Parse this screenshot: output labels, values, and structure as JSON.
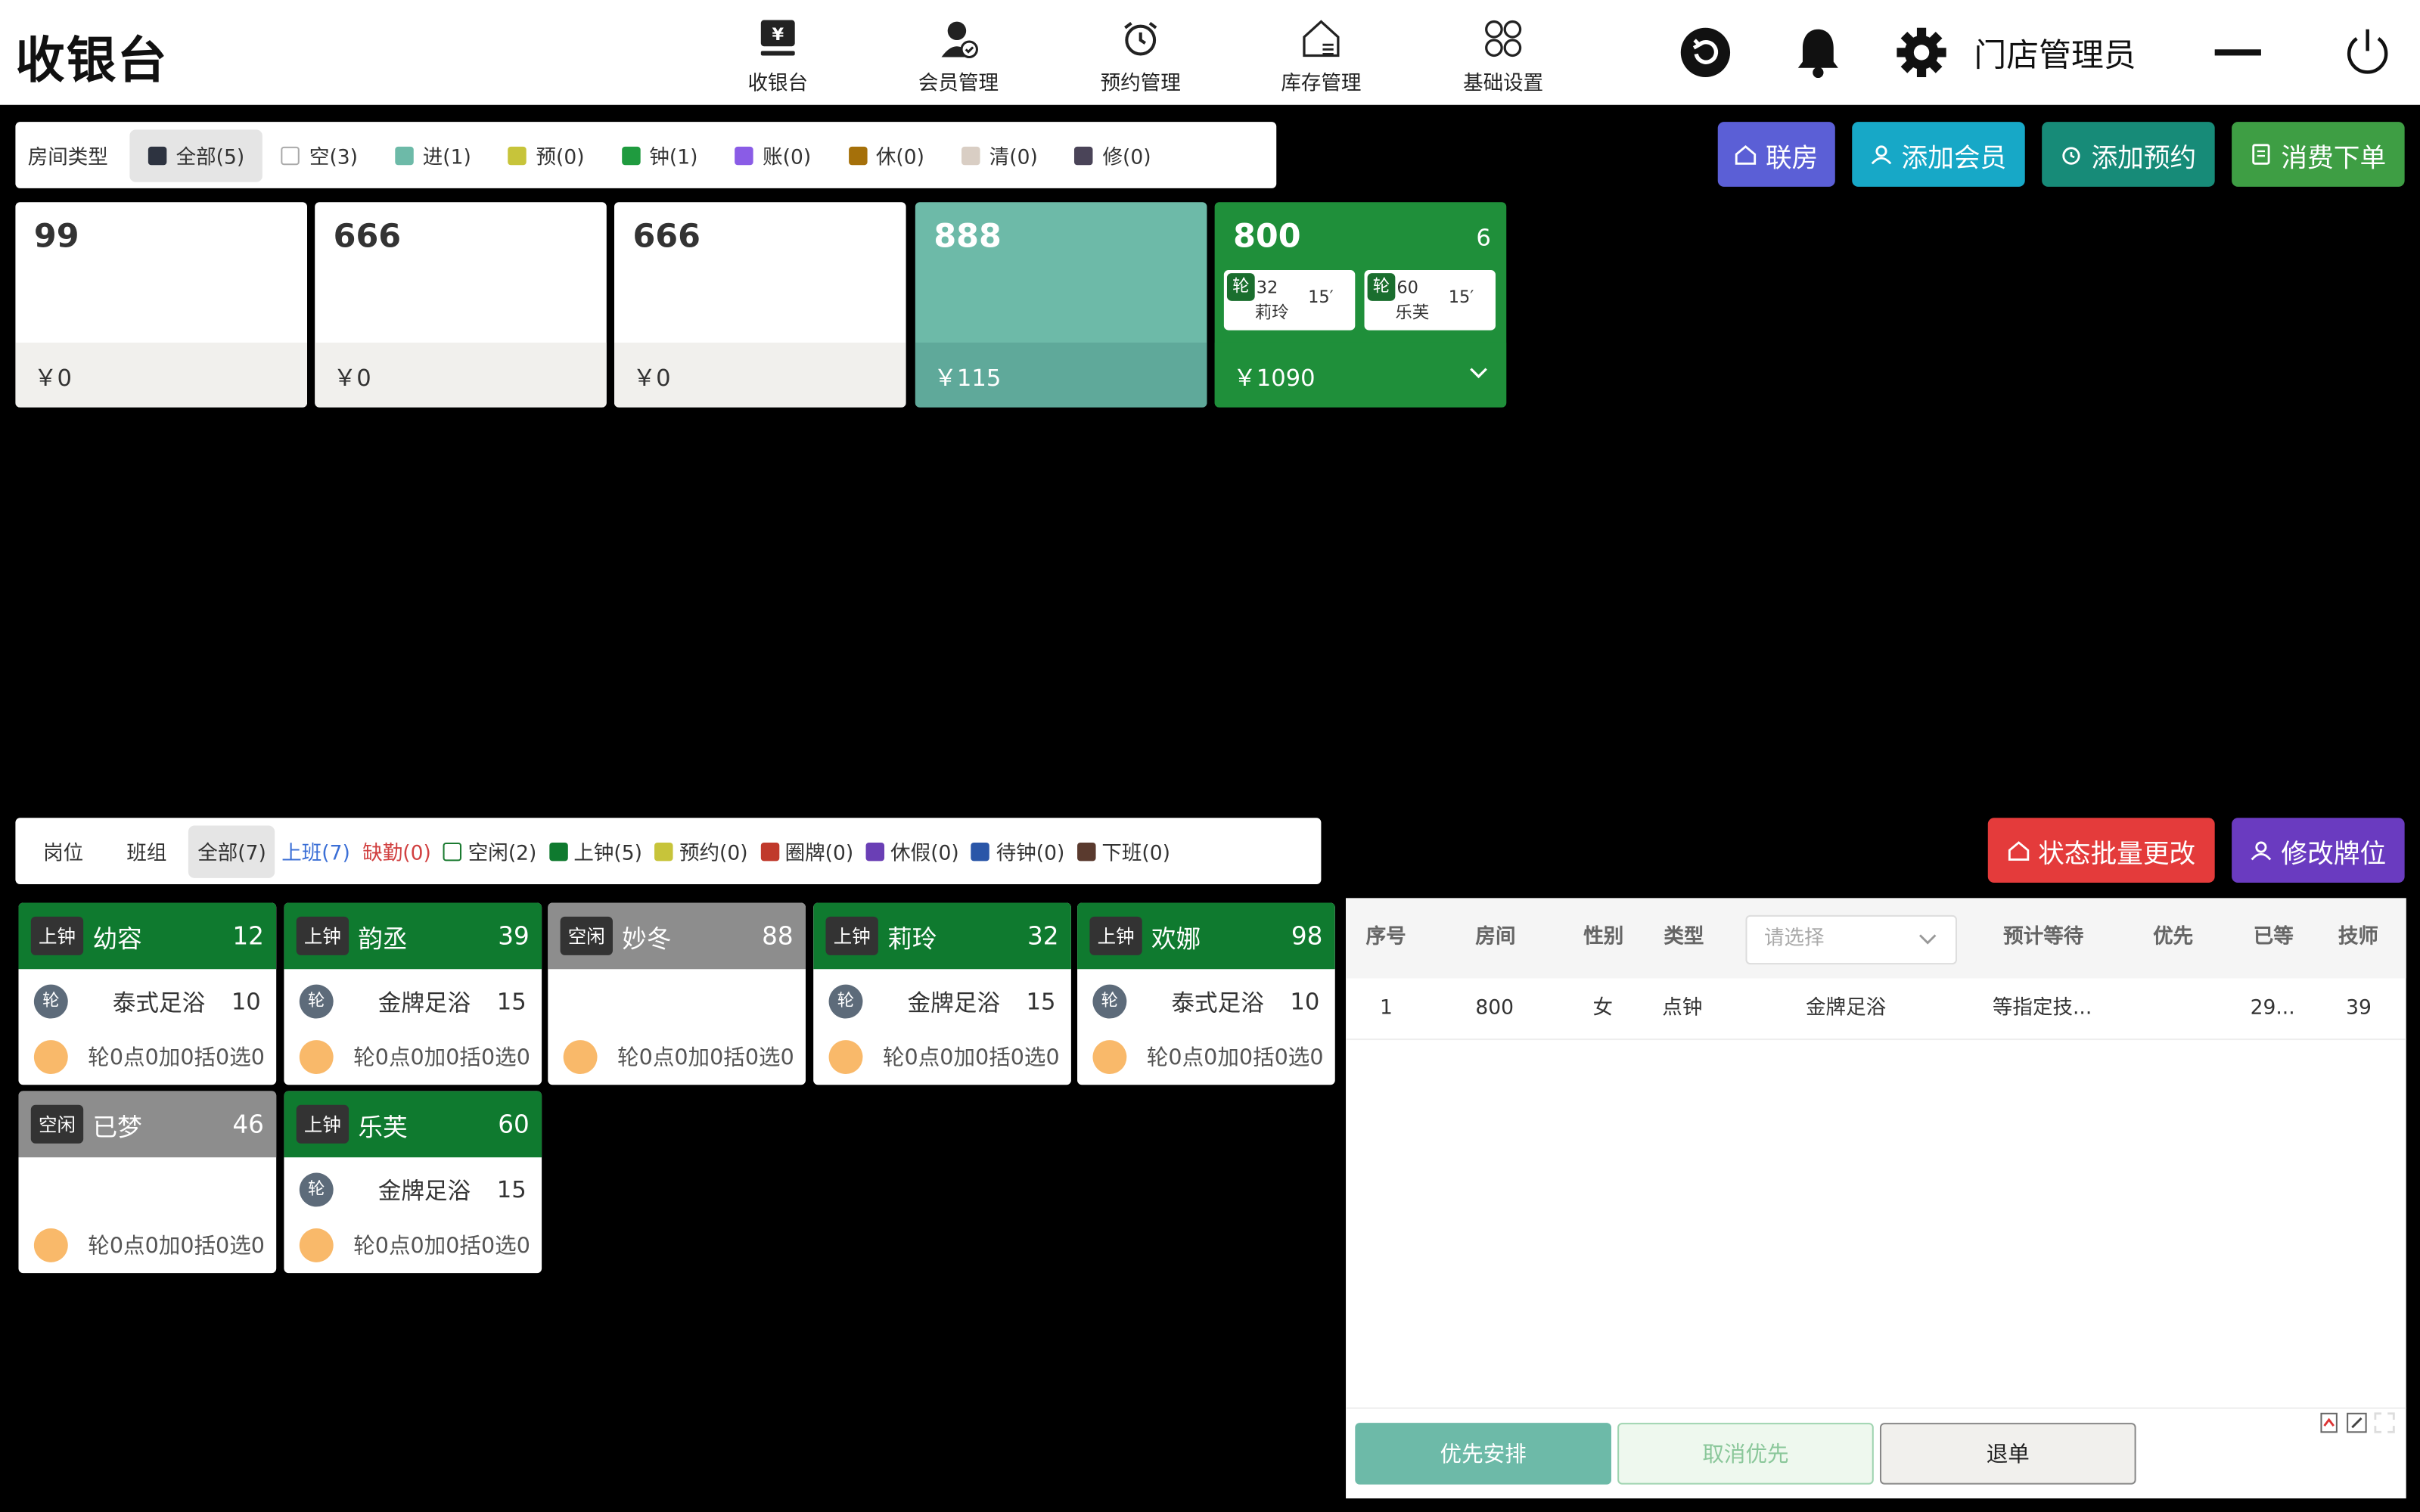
{
  "app": {
    "title": "收银台",
    "user": "门店管理员"
  },
  "nav": [
    {
      "label": "收银台",
      "icon": "cashier-icon"
    },
    {
      "label": "会员管理",
      "icon": "member-icon"
    },
    {
      "label": "预约管理",
      "icon": "alarm-clock-icon"
    },
    {
      "label": "库存管理",
      "icon": "warehouse-icon"
    },
    {
      "label": "基础设置",
      "icon": "grid-settings-icon"
    }
  ],
  "room_filter": {
    "label": "房间类型",
    "chips": [
      {
        "label": "全部(5)",
        "color": "#2d3340",
        "active": true
      },
      {
        "label": "空(3)",
        "color": "#ffffff"
      },
      {
        "label": "进(1)",
        "color": "#6dbaa8"
      },
      {
        "label": "预(0)",
        "color": "#c7c43a"
      },
      {
        "label": "钟(1)",
        "color": "#1f9b3f"
      },
      {
        "label": "账(0)",
        "color": "#8a5ce6"
      },
      {
        "label": "休(0)",
        "color": "#a5700a"
      },
      {
        "label": "清(0)",
        "color": "#d9cec4"
      },
      {
        "label": "修(0)",
        "color": "#4a4458"
      }
    ]
  },
  "actions": {
    "lianfang": "联房",
    "add_member": "添加会员",
    "add_booking": "添加预约",
    "order": "消费下单"
  },
  "rooms": [
    {
      "number": "99",
      "amount": "￥0",
      "state": "white"
    },
    {
      "number": "666",
      "amount": "￥0",
      "state": "white"
    },
    {
      "number": "666",
      "amount": "￥0",
      "state": "white"
    },
    {
      "number": "888",
      "amount": "￥115",
      "state": "teal"
    },
    {
      "number": "800",
      "amount": "￥1090",
      "state": "green",
      "count": "6",
      "techs": [
        {
          "tag": "轮",
          "num": "32",
          "name": "莉玲",
          "minutes": "15′"
        },
        {
          "tag": "轮",
          "num": "60",
          "name": "乐芙",
          "minutes": "15′"
        }
      ]
    }
  ],
  "tech_filter": {
    "chips": [
      {
        "label": "岗位"
      },
      {
        "label": "班组"
      },
      {
        "label": "全部(7)",
        "active": true
      },
      {
        "label": "上班(7)",
        "tone": "blue"
      },
      {
        "label": "缺勤(0)",
        "tone": "red"
      },
      {
        "label": "空闲(2)",
        "color": "#ffffff",
        "border": "#1a7a30"
      },
      {
        "label": "上钟(5)",
        "color": "#0f7a2f"
      },
      {
        "label": "预约(0)",
        "color": "#c7c43a"
      },
      {
        "label": "圈牌(0)",
        "color": "#c0392b"
      },
      {
        "label": "休假(0)",
        "color": "#6a3fb5"
      },
      {
        "label": "待钟(0)",
        "color": "#2a56a8"
      },
      {
        "label": "下班(0)",
        "color": "#5a3a2e"
      }
    ]
  },
  "panel_actions": {
    "batch": "状态批量更改",
    "edit_tag": "修改牌位"
  },
  "techs": [
    {
      "status": "上钟",
      "name": "幼容",
      "no": "12",
      "mode": "on",
      "tag": "轮",
      "service": "泰式足浴",
      "minutes": "10",
      "counts": "轮0点0加0括0选0"
    },
    {
      "status": "上钟",
      "name": "韵丞",
      "no": "39",
      "mode": "on",
      "tag": "轮",
      "service": "金牌足浴",
      "minutes": "15",
      "counts": "轮0点0加0括0选0"
    },
    {
      "status": "空闲",
      "name": "妙冬",
      "no": "88",
      "mode": "idle",
      "counts": "轮0点0加0括0选0"
    },
    {
      "status": "上钟",
      "name": "莉玲",
      "no": "32",
      "mode": "on",
      "tag": "轮",
      "service": "金牌足浴",
      "minutes": "15",
      "counts": "轮0点0加0括0选0"
    },
    {
      "status": "上钟",
      "name": "欢娜",
      "no": "98",
      "mode": "on",
      "tag": "轮",
      "service": "泰式足浴",
      "minutes": "10",
      "counts": "轮0点0加0括0选0"
    },
    {
      "status": "空闲",
      "name": "已梦",
      "no": "46",
      "mode": "idle",
      "counts": "轮0点0加0括0选0"
    },
    {
      "status": "上钟",
      "name": "乐芙",
      "no": "60",
      "mode": "on",
      "tag": "轮",
      "service": "金牌足浴",
      "minutes": "15",
      "counts": "轮0点0加0括0选0"
    }
  ],
  "queue": {
    "headers": {
      "seq": "序号",
      "room": "房间",
      "gender": "性别",
      "type": "类型",
      "select_placeholder": "请选择",
      "wait": "预计等待",
      "priority": "优先",
      "waited": "已等",
      "tech": "技师"
    },
    "rows": [
      {
        "seq": "1",
        "room": "800",
        "gender": "女",
        "type": "点钟",
        "service": "金牌足浴",
        "wait": "等指定技...",
        "priority": "",
        "waited": "29...",
        "tech": "39"
      }
    ],
    "buttons": {
      "priority": "优先安排",
      "cancel_priority": "取消优先",
      "refund": "退单"
    }
  }
}
